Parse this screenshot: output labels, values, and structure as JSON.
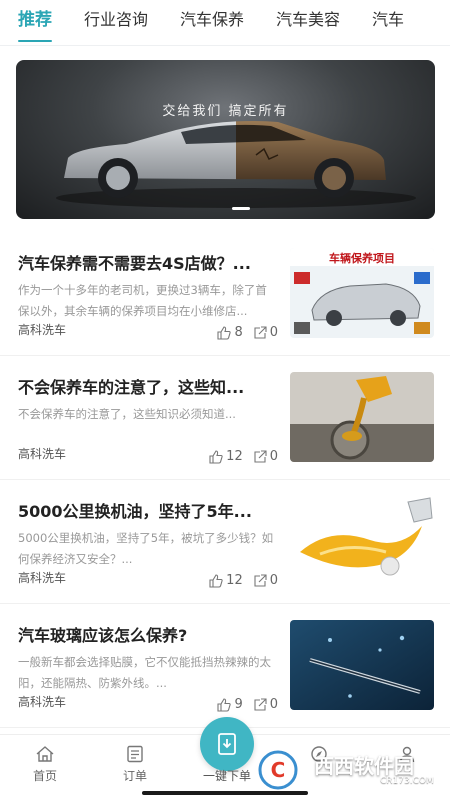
{
  "tabs": [
    {
      "label": "推荐"
    },
    {
      "label": "行业咨询"
    },
    {
      "label": "汽车保养"
    },
    {
      "label": "汽车美容"
    },
    {
      "label": "汽车"
    }
  ],
  "banner": {
    "caption": "交给我们  搞定所有"
  },
  "articles": [
    {
      "title": "汽车保养需不需要去4S店做？...",
      "summary": "作为一个十多年的老司机，更换过3辆车，除了首保以外，其余车辆的保养项目均在小维修店...",
      "source": "高科洗车",
      "likes": "8",
      "shares": "0",
      "thumb_text": "车辆保养项目"
    },
    {
      "title": "不会保养车的注意了，这些知...",
      "summary": "不会保养车的注意了，这些知识必须知道...",
      "source": "高科洗车",
      "likes": "12",
      "shares": "0"
    },
    {
      "title": "5000公里换机油，坚持了5年...",
      "summary": "5000公里换机油，坚持了5年，被坑了多少钱？如何保养经济又安全？...",
      "source": "高科洗车",
      "likes": "12",
      "shares": "0"
    },
    {
      "title": "汽车玻璃应该怎么保养?",
      "summary": "一般新车都会选择贴膜，它不仅能抵挡热辣辣的太阳，还能隔热、防紫外线。...",
      "source": "高科洗车",
      "likes": "9",
      "shares": "0"
    }
  ],
  "bottom_nav": {
    "home": "首页",
    "orders": "订单",
    "one_key": "一键下单"
  },
  "watermark": {
    "text": "西西软件园",
    "url": "CR173.COM"
  },
  "colors": {
    "accent": "#2ba6b5",
    "center_button": "#40b6c4"
  }
}
